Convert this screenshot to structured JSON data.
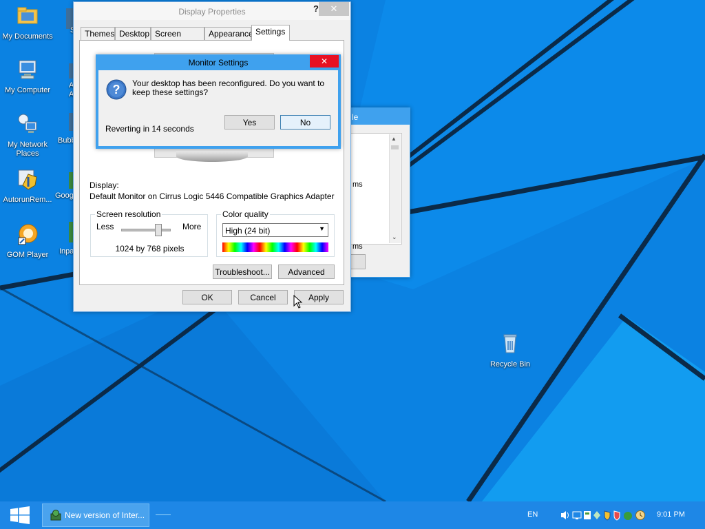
{
  "desktop": {
    "icons": [
      {
        "label": "My Documents"
      },
      {
        "label": "My Computer"
      },
      {
        "label": "My Network Places"
      },
      {
        "label": "AutorunRem..."
      },
      {
        "label": "GOM Player"
      },
      {
        "label": "Recycle Bin"
      }
    ],
    "partial_labels": [
      "S",
      "A",
      "Adi",
      "Bubb",
      "Goog",
      "Inpa"
    ]
  },
  "display_properties": {
    "title": "Display Properties",
    "help_glyph": "?",
    "close_glyph": "✕",
    "tabs": [
      "Themes",
      "Desktop",
      "Screen Saver",
      "Appearance",
      "Settings"
    ],
    "active_tab": "Settings",
    "display_label": "Display:",
    "display_value": "Default Monitor on Cirrus Logic 5446 Compatible Graphics Adapter",
    "screen_resolution": {
      "label": "Screen resolution",
      "less": "Less",
      "more": "More",
      "value_text": "1024 by 768 pixels",
      "slider_level": 0.75
    },
    "color_quality": {
      "label": "Color quality",
      "selected": "High (24 bit)"
    },
    "troubleshoot_label": "Troubleshoot...",
    "advanced_label": "Advanced",
    "ok_label": "OK",
    "cancel_label": "Cancel",
    "apply_label": "Apply"
  },
  "monitor_settings": {
    "title": "Monitor Settings",
    "close_glyph": "✕",
    "message": "Your desktop has been reconfigured.  Do you want to keep these settings?",
    "countdown": "Reverting in 14 seconds",
    "yes_label": "Yes",
    "no_label": "No"
  },
  "background_window": {
    "title_fragment": "le",
    "list_fragments": [
      "ms",
      "ms"
    ]
  },
  "taskbar": {
    "app_label": "New version of Inter...",
    "language": "EN",
    "time": "9:01 PM"
  },
  "colors": {
    "accent": "#e81123",
    "taskbar": "#1e87e6",
    "focus_border": "#3c7fb1"
  }
}
